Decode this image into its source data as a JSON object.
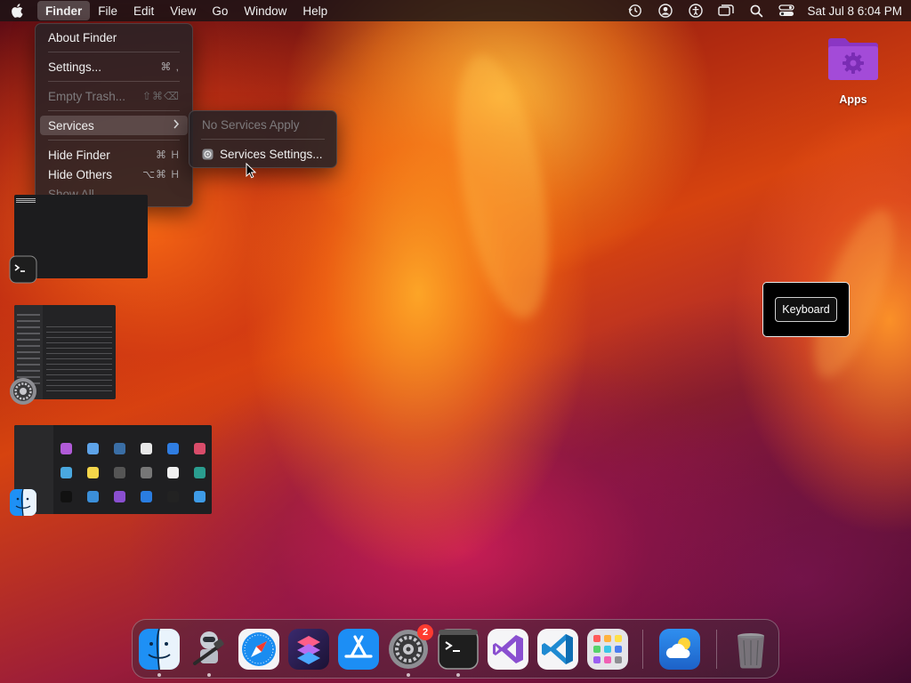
{
  "menubar": {
    "app_name": "Finder",
    "menus": [
      "File",
      "Edit",
      "View",
      "Go",
      "Window",
      "Help"
    ],
    "clock": "Sat Jul 8  6:04 PM",
    "status_icons": [
      "time-machine-icon",
      "user-icon",
      "accessibility-icon",
      "screens-icon",
      "spotlight-icon",
      "control-center-icon"
    ]
  },
  "finder_menu": {
    "items": [
      {
        "label": "About Finder",
        "shortcut": "",
        "enabled": true
      },
      {
        "label": "Settings...",
        "shortcut": "⌘ ,",
        "enabled": true
      },
      {
        "label": "Empty Trash...",
        "shortcut": "⇧⌘⌫",
        "enabled": false
      },
      {
        "label": "Services",
        "shortcut": "",
        "enabled": true,
        "submenu": true,
        "selected": true
      },
      {
        "label": "Hide Finder",
        "shortcut": "⌘ H",
        "enabled": true
      },
      {
        "label": "Hide Others",
        "shortcut": "⌥⌘ H",
        "enabled": true
      },
      {
        "label": "Show All",
        "shortcut": "",
        "enabled": false
      }
    ]
  },
  "services_submenu": {
    "items": [
      {
        "label": "No Services Apply",
        "enabled": false
      },
      {
        "label": "Services Settings...",
        "enabled": true,
        "icon": "gear-icon"
      }
    ]
  },
  "desktop": {
    "folder_label": "Apps",
    "keyboard_hud_label": "Keyboard"
  },
  "stage_manager": {
    "windows": [
      "terminal",
      "system-settings",
      "finder"
    ]
  },
  "dock": {
    "apps": [
      "Finder",
      "Automator",
      "Safari",
      "Shortcuts",
      "App Store",
      "System Settings",
      "Terminal",
      "Visual Studio",
      "Visual Studio Code",
      "Launchpad",
      "Weather",
      "Trash"
    ],
    "system_settings_badge": "2"
  },
  "colors": {
    "menu_bg": "#28222699",
    "selection": "#ffffff2b",
    "folder": "#a34bd8",
    "badge": "#ff3b30"
  }
}
